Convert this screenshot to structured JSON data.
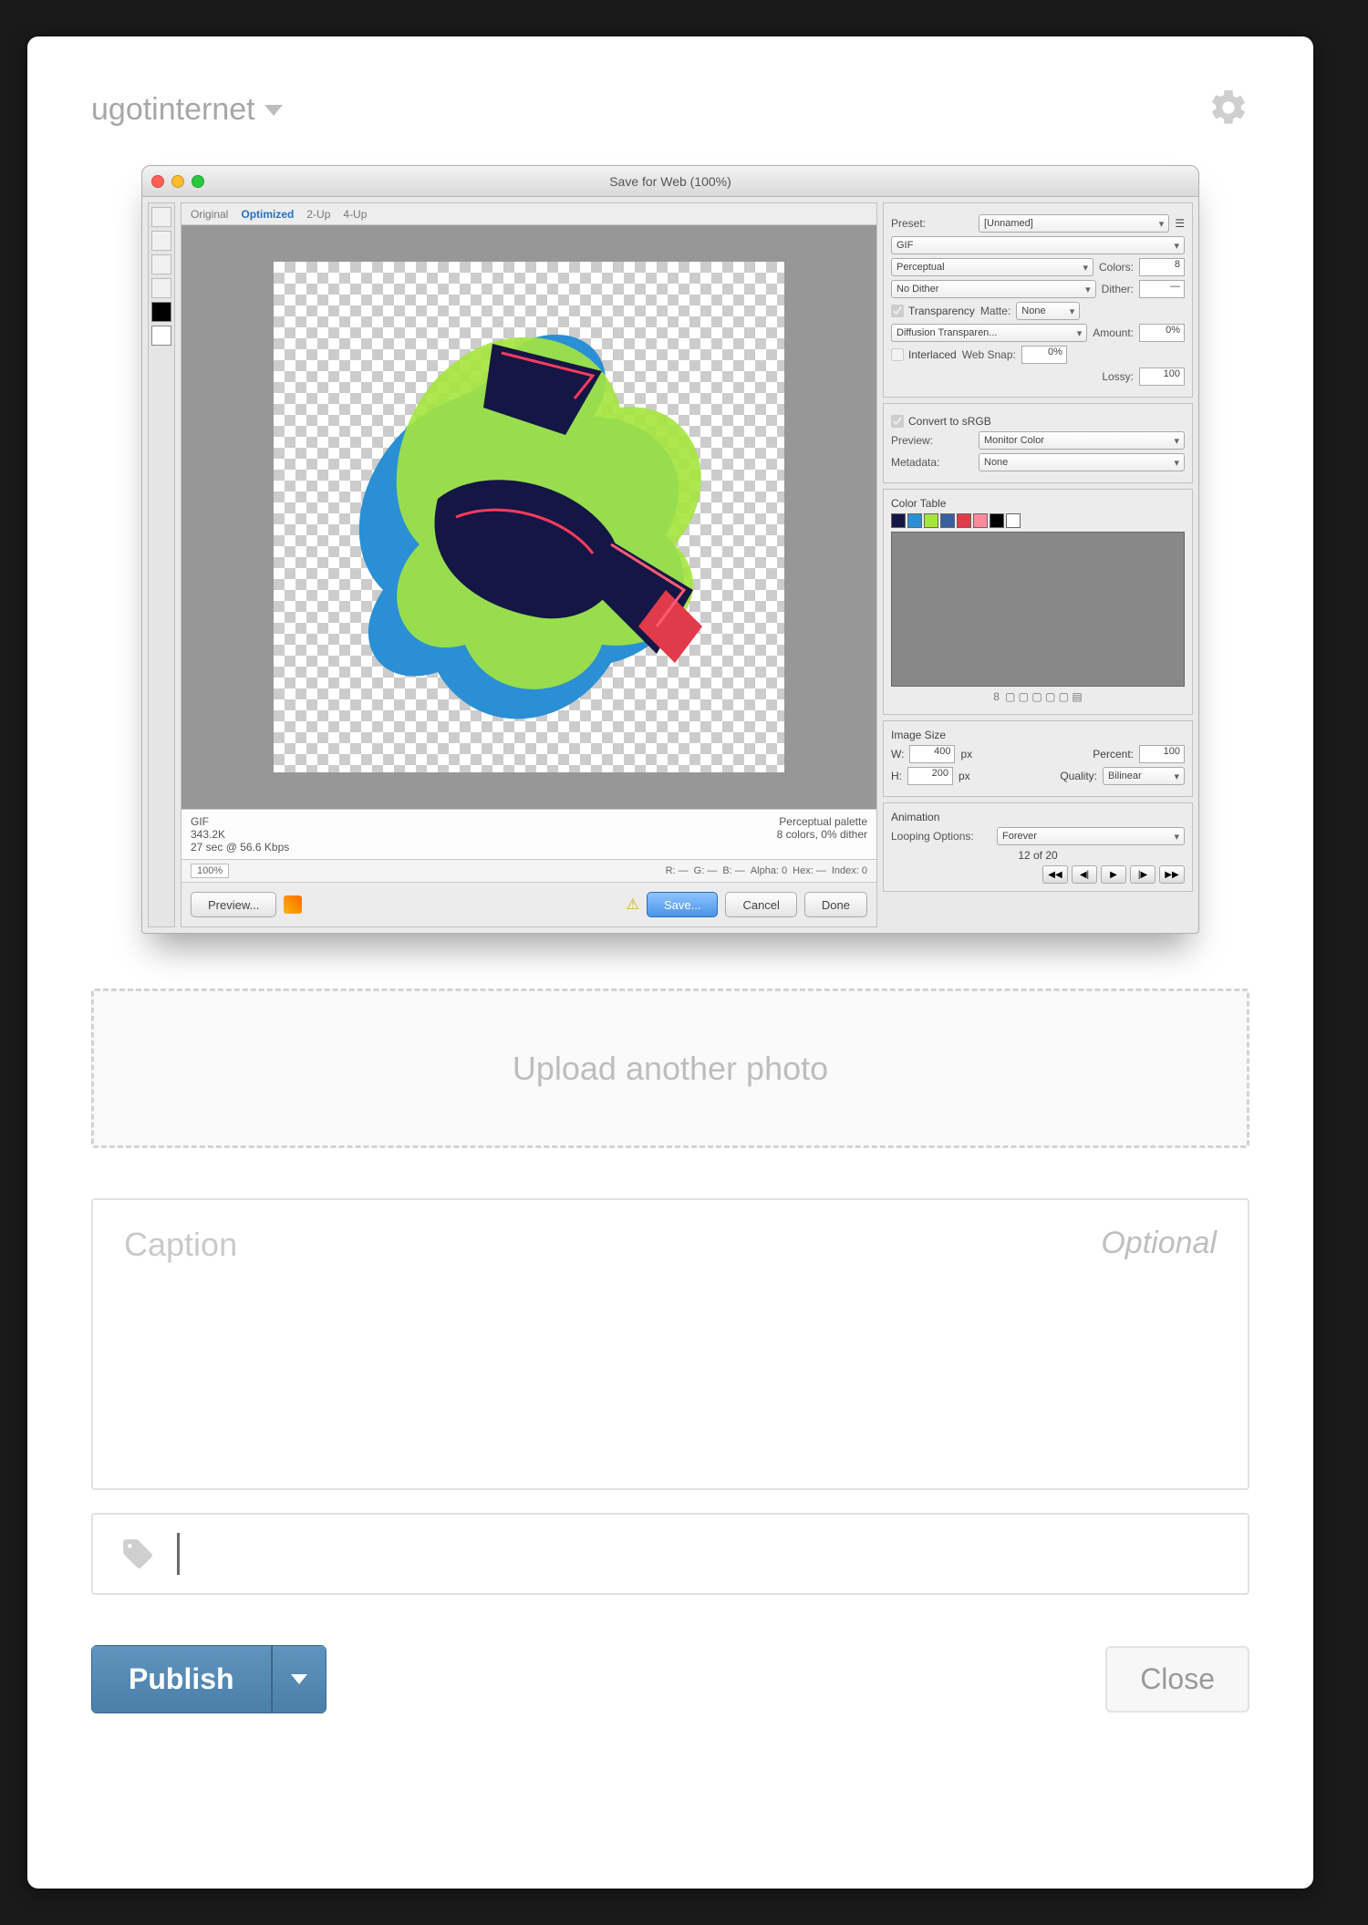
{
  "header": {
    "blog_name": "ugotinternet"
  },
  "preview": {
    "window_title": "Save for Web (100%)",
    "tabs": [
      "Original",
      "Optimized",
      "2-Up",
      "4-Up"
    ],
    "status_left_1": "GIF",
    "status_left_2": "343.2K",
    "status_left_3": "27 sec @ 56.6 Kbps",
    "status_right_1": "Perceptual palette",
    "status_right_2": "8 colors, 0% dither",
    "zoombar": {
      "zoom": "100%",
      "r": "R: —",
      "g": "G: —",
      "b": "B: —",
      "alpha": "Alpha: 0",
      "hex": "Hex: —",
      "index": "Index: 0"
    },
    "side": {
      "preset_label": "Preset:",
      "preset_value": "[Unnamed]",
      "format": "GIF",
      "reduction": "Perceptual",
      "colors_label": "Colors:",
      "colors": "8",
      "dither": "No Dither",
      "dither_label": "Dither:",
      "dither_pct": "—",
      "transparency": "Transparency",
      "matte_label": "Matte:",
      "matte": "None",
      "trans_dither": "Diffusion Transparen...",
      "amount_label": "Amount:",
      "amount": "0%",
      "interlaced": "Interlaced",
      "websnap_label": "Web Snap:",
      "websnap": "0%",
      "lossy_label": "Lossy:",
      "lossy": "100",
      "convert_srgb": "Convert to sRGB",
      "preview_label": "Preview:",
      "preview": "Monitor Color",
      "metadata_label": "Metadata:",
      "metadata": "None",
      "colortable_label": "Color Table",
      "imgsize_label": "Image Size",
      "w_label": "W:",
      "w": "400",
      "h_label": "H:",
      "h": "200",
      "unit": "px",
      "percent_label": "Percent:",
      "percent": "100",
      "quality_label": "Quality:",
      "quality": "Bilinear",
      "animation_label": "Animation",
      "loop_label": "Looping Options:",
      "loop": "Forever",
      "frame_info": "12 of 20"
    },
    "footer": {
      "preview_btn": "Preview...",
      "save_btn": "Save...",
      "cancel_btn": "Cancel",
      "done_btn": "Done"
    }
  },
  "upload_another": "Upload another photo",
  "caption": {
    "label": "Caption",
    "optional": "Optional"
  },
  "footer": {
    "publish": "Publish",
    "close": "Close"
  }
}
